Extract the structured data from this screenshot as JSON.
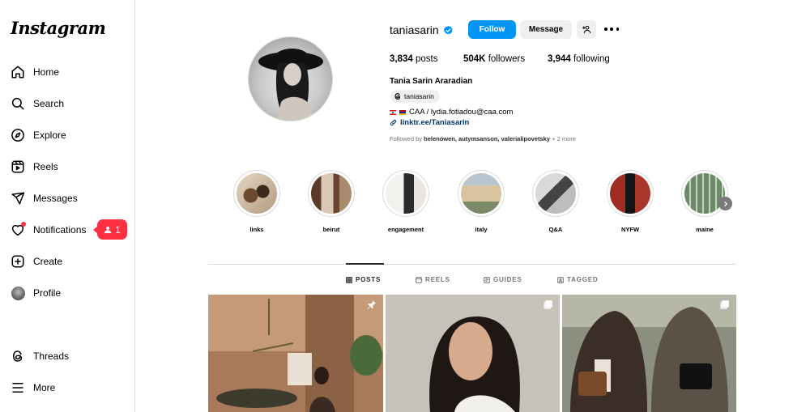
{
  "sidebar": {
    "logo": "Instagram",
    "items": [
      {
        "label": "Home",
        "icon": "home-icon"
      },
      {
        "label": "Search",
        "icon": "search-icon"
      },
      {
        "label": "Explore",
        "icon": "compass-icon"
      },
      {
        "label": "Reels",
        "icon": "reels-icon"
      },
      {
        "label": "Messages",
        "icon": "send-icon"
      },
      {
        "label": "Notifications",
        "icon": "heart-icon"
      },
      {
        "label": "Create",
        "icon": "plus-square-icon"
      },
      {
        "label": "Profile",
        "icon": "avatar-icon"
      },
      {
        "label": "Threads",
        "icon": "threads-icon"
      },
      {
        "label": "More",
        "icon": "menu-icon"
      }
    ],
    "notification_badge": "1"
  },
  "profile": {
    "username": "taniasarin",
    "verified": true,
    "follow_label": "Follow",
    "message_label": "Message",
    "stats": {
      "posts_count": "3,834",
      "posts_label": "posts",
      "followers_count": "504K",
      "followers_label": "followers",
      "following_count": "3,944",
      "following_label": "following"
    },
    "full_name": "Tania Sarin Araradian",
    "threads_handle": "taniasarin",
    "bio_text": "CAA / lydia.fotiadou@caa.com",
    "link": "linktr.ee/Taniasarin",
    "followed_by_prefix": "Followed by",
    "followed_by_names": "helenowen, autymsanson, valerialipovetsky",
    "followed_by_more": "+ 2 more"
  },
  "highlights": [
    {
      "label": "links"
    },
    {
      "label": "beirut"
    },
    {
      "label": "engagement"
    },
    {
      "label": "italy"
    },
    {
      "label": "Q&A"
    },
    {
      "label": "NYFW"
    },
    {
      "label": "maine"
    }
  ],
  "tabs": [
    {
      "label": "POSTS",
      "active": true
    },
    {
      "label": "REELS",
      "active": false
    },
    {
      "label": "GUIDES",
      "active": false
    },
    {
      "label": "TAGGED",
      "active": false
    }
  ],
  "colors": {
    "accent": "#0095f6",
    "badge": "#ff3040",
    "link": "#00376b",
    "verified": "#0095f6"
  }
}
